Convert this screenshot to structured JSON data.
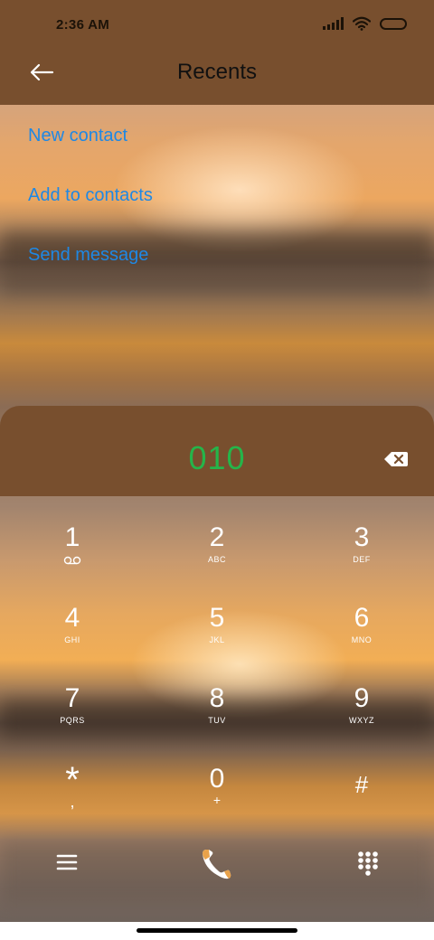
{
  "status_bar": {
    "time": "2:36 AM"
  },
  "header": {
    "title": "Recents"
  },
  "actions": [
    {
      "label": "New contact"
    },
    {
      "label": "Add to contacts"
    },
    {
      "label": "Send message"
    }
  ],
  "dialer": {
    "number": "010",
    "keys": [
      {
        "digit": "1",
        "sub": "voicemail-icon"
      },
      {
        "digit": "2",
        "sub": "ABC"
      },
      {
        "digit": "3",
        "sub": "DEF"
      },
      {
        "digit": "4",
        "sub": "GHI"
      },
      {
        "digit": "5",
        "sub": "JKL"
      },
      {
        "digit": "6",
        "sub": "MNO"
      },
      {
        "digit": "7",
        "sub": "PQRS"
      },
      {
        "digit": "8",
        "sub": "TUV"
      },
      {
        "digit": "9",
        "sub": "WXYZ"
      },
      {
        "digit": "*",
        "sub": ","
      },
      {
        "digit": "0",
        "sub": "+"
      },
      {
        "digit": "#",
        "sub": ""
      }
    ]
  },
  "colors": {
    "header_bg": "#784f2e",
    "link": "#1e88e5",
    "dial_number": "#25b54a"
  }
}
